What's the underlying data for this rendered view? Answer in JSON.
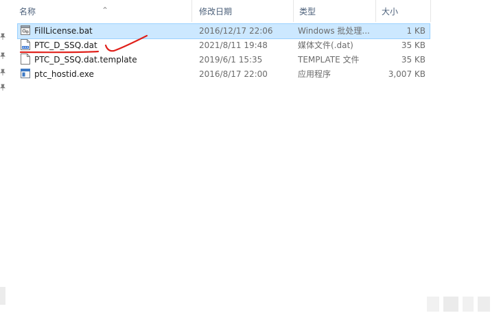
{
  "columns": {
    "name": "名称",
    "date": "修改日期",
    "type": "类型",
    "size": "大小"
  },
  "files": [
    {
      "name": "FillLicense.bat",
      "date": "2016/12/17 22:06",
      "type": "Windows 批处理...",
      "size": "1 KB",
      "icon": "batch-file-icon"
    },
    {
      "name": "PTC_D_SSQ.dat",
      "date": "2021/8/11 19:48",
      "type": "媒体文件(.dat)",
      "size": "35 KB",
      "icon": "media-file-icon"
    },
    {
      "name": "PTC_D_SSQ.dat.template",
      "date": "2019/6/1 15:35",
      "type": "TEMPLATE 文件",
      "size": "35 KB",
      "icon": "blank-file-icon"
    },
    {
      "name": "ptc_hostid.exe",
      "date": "2016/8/17 22:00",
      "type": "应用程序",
      "size": "3,007 KB",
      "icon": "exe-file-icon"
    }
  ],
  "colors": {
    "selection": "#cce8ff",
    "selection_border": "#99d1ff",
    "annotation": "#e0201a"
  }
}
